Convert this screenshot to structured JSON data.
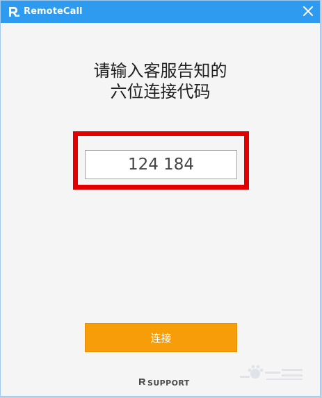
{
  "app": {
    "title": "RemoteCall",
    "logo_icon": "remotecall-logo-icon",
    "close_icon": "close-icon",
    "accent_color": "#2f9bf0"
  },
  "main": {
    "heading_line1": "请输入客服告知的",
    "heading_line2": "六位连接代码",
    "code_value": "124 184",
    "highlight_color": "#e20000",
    "connect_label": "连接",
    "connect_color": "#f79d0a"
  },
  "footer": {
    "brand_text": "SUPPORT",
    "brand_icon": "rsupport-logo-icon"
  }
}
